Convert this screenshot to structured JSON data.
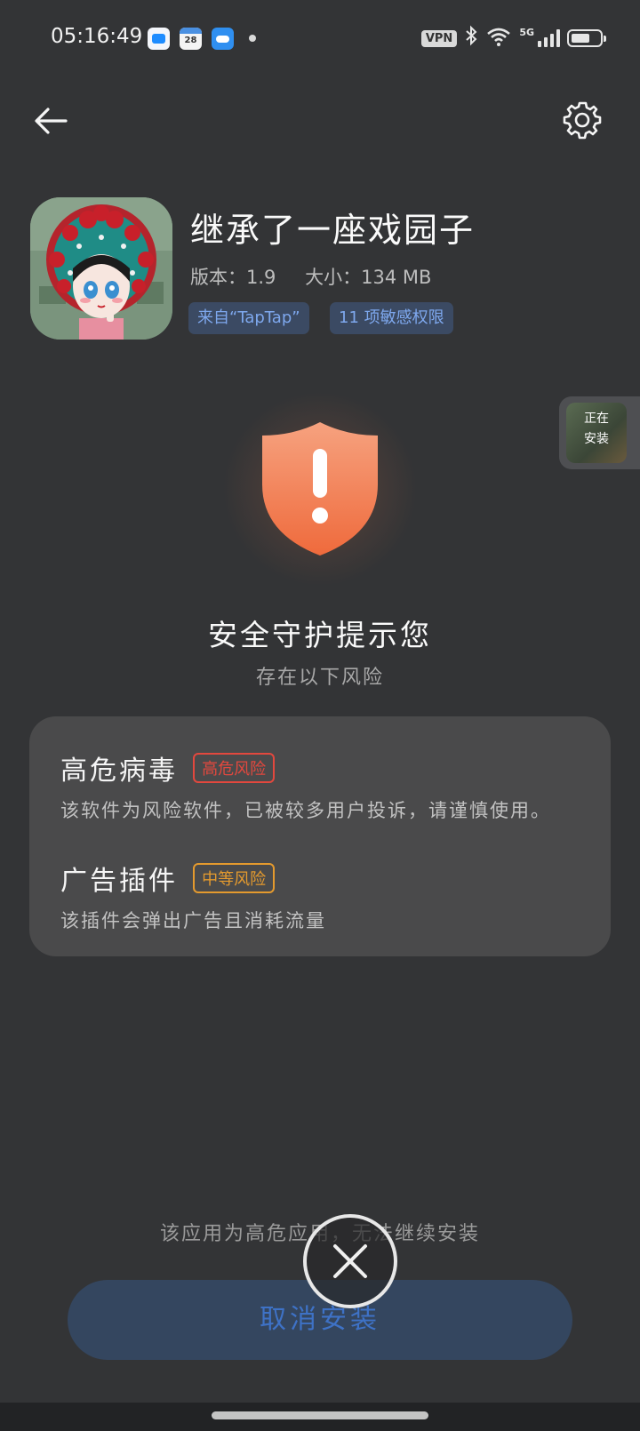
{
  "status_bar": {
    "time": "05:16:49",
    "calendar_day": "28",
    "vpn_label": "VPN",
    "network_label": "5G",
    "icons": [
      "messages-icon",
      "calendar-icon",
      "weather-icon",
      "bluetooth-icon",
      "wifi-icon",
      "signal-icon",
      "battery-icon"
    ]
  },
  "header": {
    "back_icon": "arrow-left-icon",
    "settings_icon": "gear-icon"
  },
  "app": {
    "name": "继承了一座戏园子",
    "version": "版本：1.9",
    "size": "大小：134 MB",
    "tags": [
      "来自“TapTap”",
      "11 项敏感权限"
    ]
  },
  "floating_install": {
    "label": "正在安装"
  },
  "security": {
    "title": "安全守护提示您",
    "subtitle": "存在以下风险",
    "risks": [
      {
        "name": "高危病毒",
        "level": "高危风险",
        "level_color": "#e2483e",
        "description": "该软件为风险软件，已被较多用户投诉，请谨慎使用。"
      },
      {
        "name": "广告插件",
        "level": "中等风险",
        "level_color": "#e49a2e",
        "description": "该插件会弹出广告且消耗流量"
      }
    ]
  },
  "footer": {
    "warning": "该应用为高危应用，无法继续安装",
    "cancel_label": "取消安装"
  },
  "colors": {
    "background": "#333436",
    "card": "#4a4a4b",
    "accent_blue": "#3e72c6",
    "shield": "#f07a4c"
  }
}
